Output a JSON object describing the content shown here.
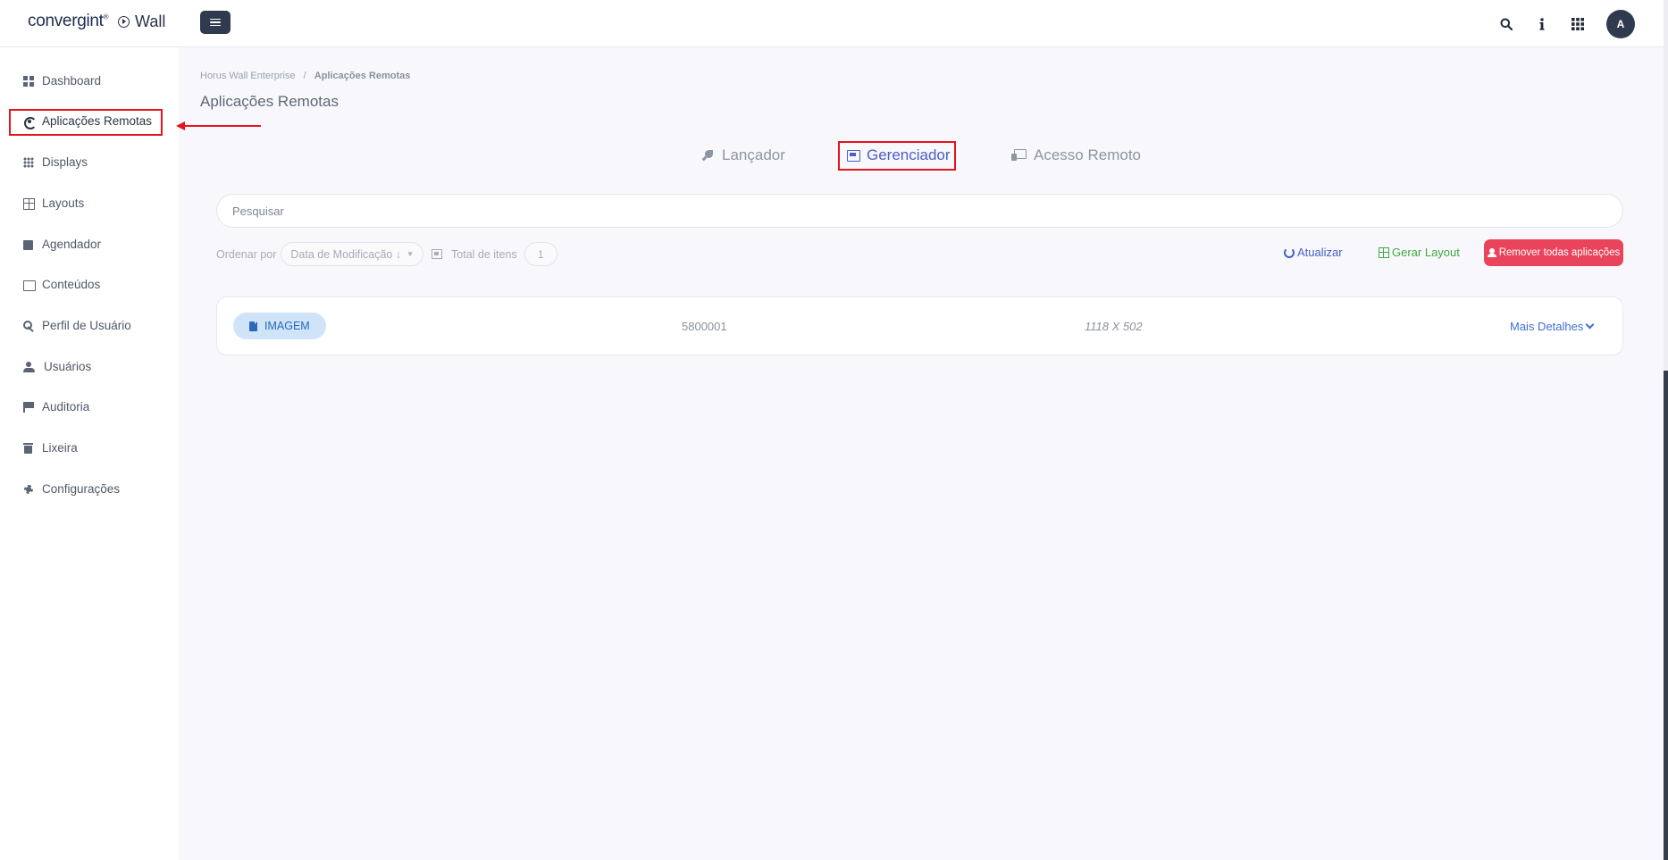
{
  "header": {
    "logo_text": "convergint",
    "logo_mark": "®",
    "app_name": "Wall",
    "avatar_initial": "A",
    "icons": [
      "search-icon",
      "info-icon",
      "apps-grid-icon"
    ]
  },
  "sidebar": {
    "items": [
      {
        "label": "Dashboard",
        "icon": "dashboard-icon"
      },
      {
        "label": "Aplicações Remotas",
        "icon": "satellite-icon",
        "active": true
      },
      {
        "label": "Displays",
        "icon": "displays-icon"
      },
      {
        "label": "Layouts",
        "icon": "layouts-icon"
      },
      {
        "label": "Agendador",
        "icon": "calendar-icon"
      },
      {
        "label": "Conteúdos",
        "icon": "image-icon"
      },
      {
        "label": "Perfil de Usuário",
        "icon": "key-icon"
      },
      {
        "label": "Usuários",
        "icon": "users-icon"
      },
      {
        "label": "Auditoria",
        "icon": "flag-icon"
      },
      {
        "label": "Lixeira",
        "icon": "trash-icon"
      },
      {
        "label": "Configurações",
        "icon": "gear-icon"
      }
    ]
  },
  "breadcrumb": {
    "root": "Horus Wall Enterprise",
    "separator": "/",
    "current": "Aplicações Remotas"
  },
  "page_title": "Aplicações Remotas",
  "tabs": [
    {
      "label": "Lançador",
      "icon": "rocket-icon"
    },
    {
      "label": "Gerenciador",
      "icon": "window-icon",
      "active": true
    },
    {
      "label": "Acesso Remoto",
      "icon": "remote-desktop-icon"
    }
  ],
  "search": {
    "placeholder": "Pesquisar",
    "value": ""
  },
  "toolbar": {
    "sort_label": "Ordenar por",
    "sort_value": "Data de Modificação ↓",
    "total_label": "Total de itens",
    "total_count": "1",
    "refresh_label": "Atualizar",
    "layout_label": "Gerar Layout",
    "remove_all_label": "Remover todas aplicações"
  },
  "items": [
    {
      "type": "IMAGEM",
      "id": "5800001",
      "resolution": "1118 X 502",
      "details_label": "Mais Detalhes"
    }
  ],
  "colors": {
    "primary": "#4b5fc7",
    "success": "#41a943",
    "danger": "#e9445b",
    "annotation": "#e3141d",
    "dark": "#303a4f"
  }
}
